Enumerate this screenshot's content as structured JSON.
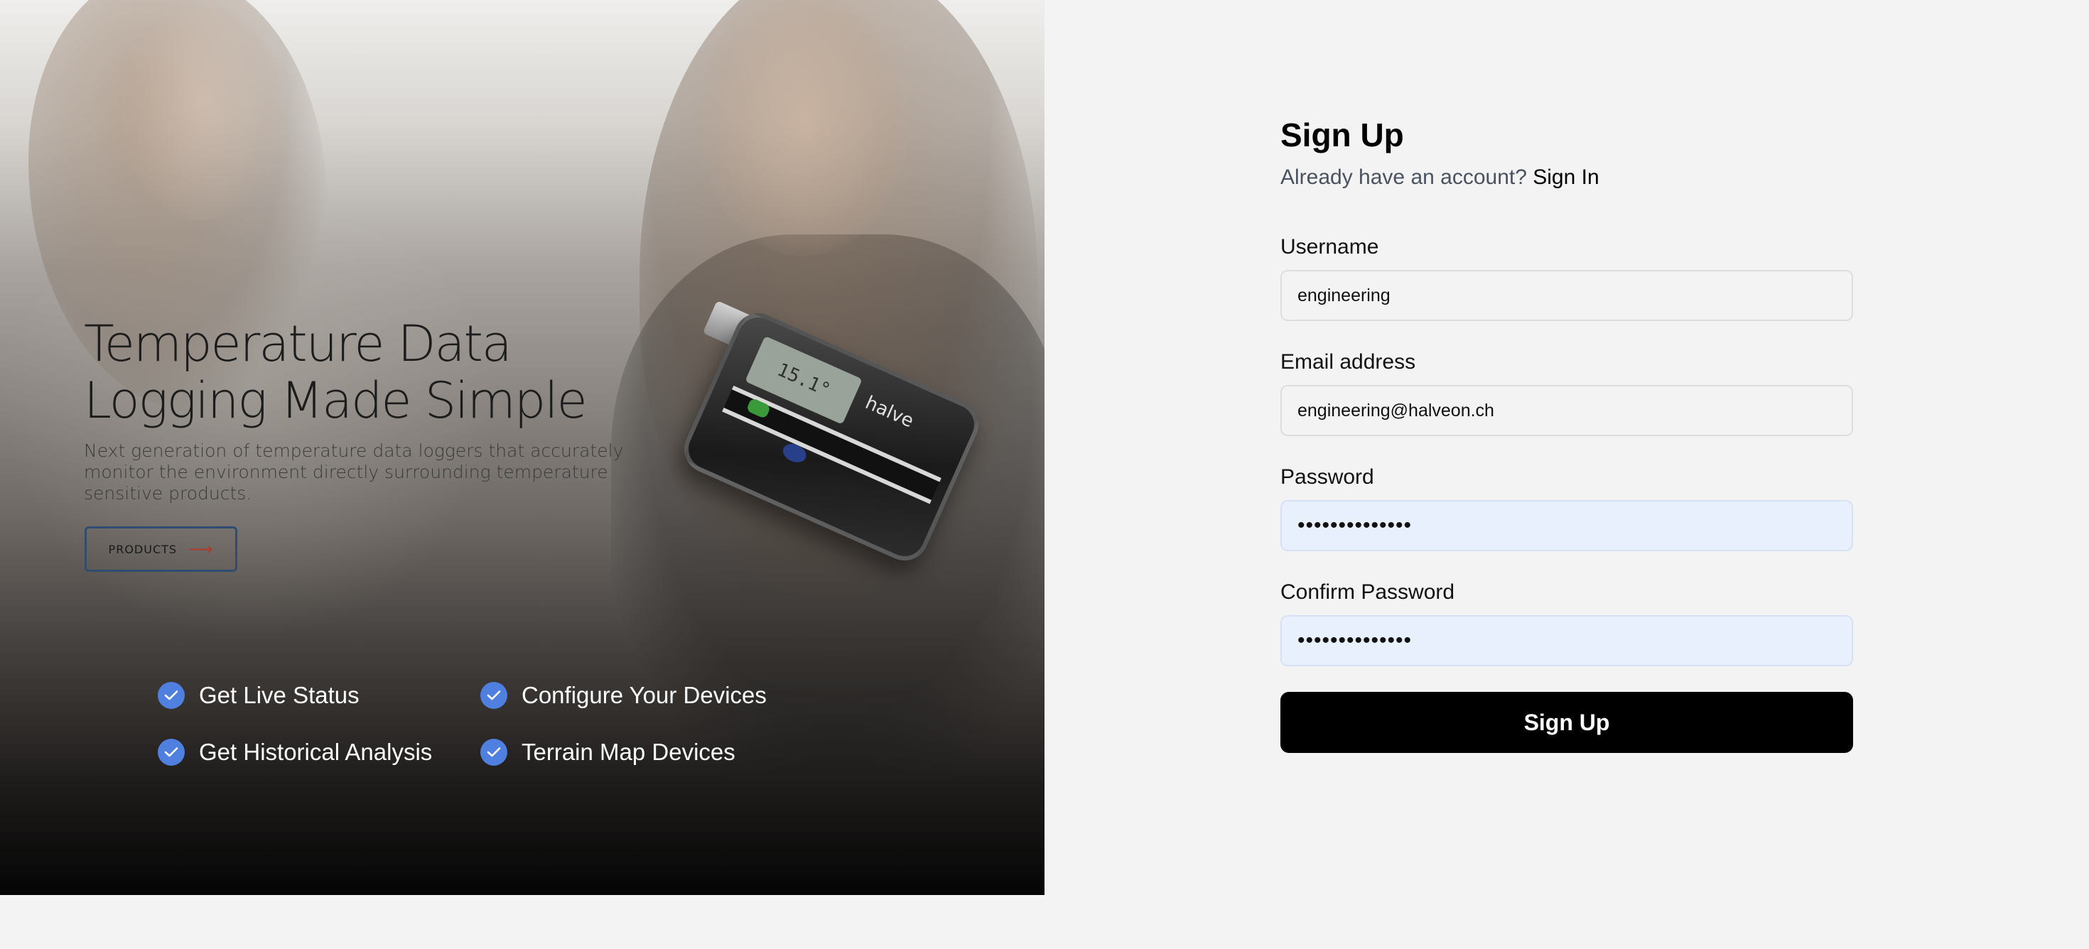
{
  "hero": {
    "title": "Temperature Data Logging Made Simple",
    "subtitle": "Next generation of temperature data loggers that accurately monitor the environment directly surrounding temperature sensitive products.",
    "products_button": "PRODUCTS",
    "products_arrow": "⟶",
    "device": {
      "screen_reading": "15.1°",
      "brand": "halve"
    },
    "features": [
      {
        "label": "Get Live Status",
        "icon": "check-icon"
      },
      {
        "label": "Configure Your Devices",
        "icon": "check-icon"
      },
      {
        "label": "Get Historical Analysis",
        "icon": "check-icon"
      },
      {
        "label": "Terrain Map Devices",
        "icon": "check-icon"
      }
    ]
  },
  "form": {
    "title": "Sign Up",
    "signin_prompt": "Already have an account?",
    "signin_link": "Sign In",
    "username": {
      "label": "Username",
      "value": "engineering"
    },
    "email": {
      "label": "Email address",
      "value": "engineering@halveon.ch"
    },
    "password": {
      "label": "Password",
      "value": "••••••••••••••"
    },
    "confirm_password": {
      "label": "Confirm Password",
      "value": "••••••••••••••"
    },
    "submit_label": "Sign Up"
  },
  "colors": {
    "accent": "#4f80e0",
    "button": "#000000",
    "autofill": "#e8f0fe",
    "page_bg": "#f3f3f3"
  }
}
